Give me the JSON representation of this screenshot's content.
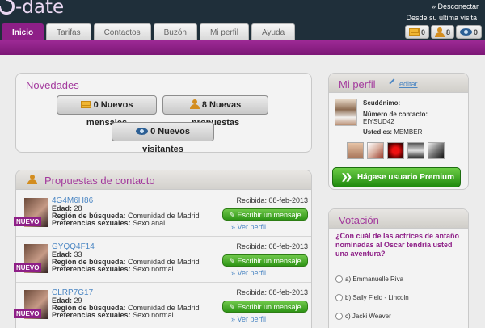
{
  "header": {
    "logo": "-date",
    "disconnect": "» Desconectar",
    "last_visit": "Desde su última visita",
    "counters": {
      "messages": "0",
      "proposals": "8",
      "visitors": "0"
    }
  },
  "tabs": [
    {
      "label": "Inicio"
    },
    {
      "label": "Tarifas"
    },
    {
      "label": "Contactos"
    },
    {
      "label": "Buzón"
    },
    {
      "label": "Mi perfil"
    },
    {
      "label": "Ayuda"
    }
  ],
  "novedades": {
    "title": "Novedades",
    "messages_btn": "0 Nuevos mensajes",
    "proposals_btn": "8 Nuevas propuestas",
    "visitors_btn": "0 Nuevos visitantes"
  },
  "propuestas": {
    "title": "Propuestas de contacto",
    "nuevo": "NUEVO",
    "edad_label": "Edad:",
    "region_label": "Región de búsqueda:",
    "pref_label": "Preferencias sexuales:",
    "write_label": "Escribir un mensaje",
    "see_label": "» Ver perfil",
    "items": [
      {
        "name": "4G4M6H86",
        "edad": "28",
        "region": "Comunidad de Madrid",
        "pref": "Sexo anal ...",
        "received": "Recibida: 08-feb-2013"
      },
      {
        "name": "GYQQ4F14",
        "edad": "33",
        "region": "Comunidad de Madrid",
        "pref": "Sexo normal ...",
        "received": "Recibida: 08-feb-2013"
      },
      {
        "name": "CLRP7G17",
        "edad": "29",
        "region": "Comunidad de Madrid",
        "pref": "Sexo normal ...",
        "received": "Recibida: 08-feb-2013"
      }
    ]
  },
  "perfil": {
    "title": "Mi perfil",
    "edit": "editar",
    "seudonimo_label": "Seudónimo:",
    "contact_label": "Número de contacto:",
    "contact_value": "EIYSUD42",
    "usted_label": "Usted es:",
    "usted_value": "MEMBER",
    "premium": "Hágase usuario Premium"
  },
  "votacion": {
    "title": "Votación",
    "question": "¿Con cuál de las actrices de antaño nominadas al Oscar tendría usted una aventura?",
    "options": [
      "a) Emmanuelle Riva",
      "b) Sally Field - Lincoln",
      "c) Jacki Weaver"
    ]
  }
}
